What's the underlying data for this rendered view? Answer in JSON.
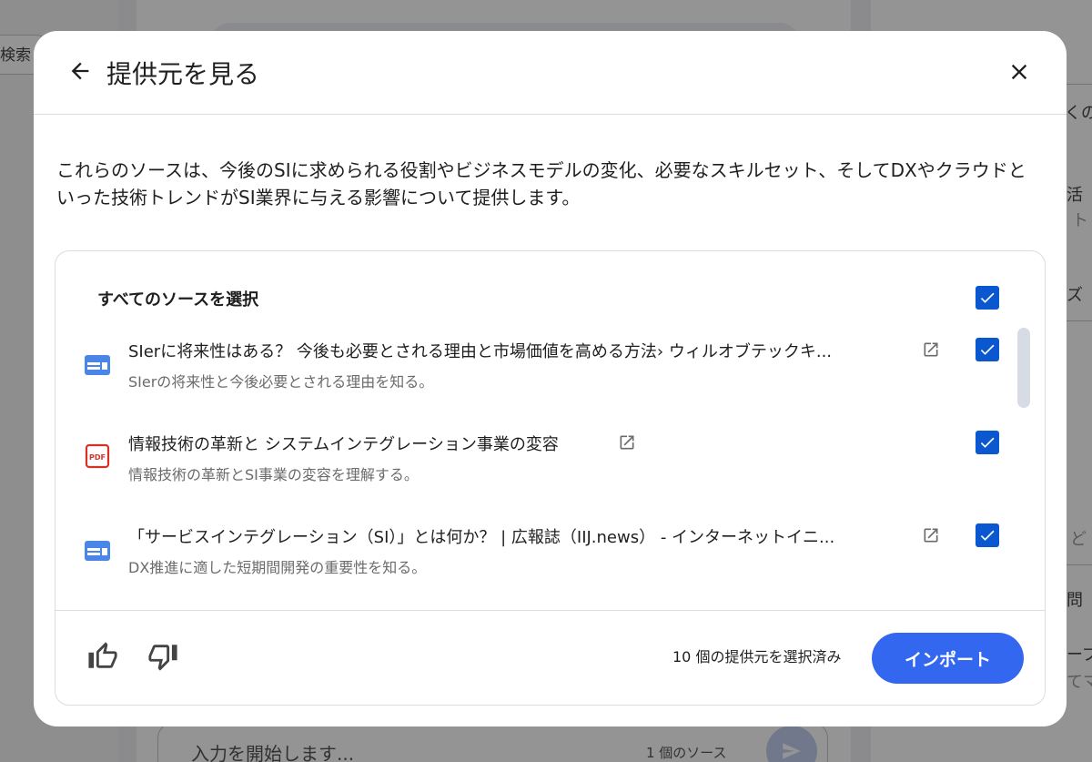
{
  "background": {
    "search_label": "検索",
    "right_texts": [
      "くの",
      "活",
      "ト",
      "ズ",
      "ど",
      "問",
      "ープ",
      "てマ"
    ],
    "input_placeholder": "入力を開始します...",
    "source_count": "1 個のソース"
  },
  "modal": {
    "title": "提供元を見る",
    "description": "これらのソースは、今後のSIに求められる役割やビジネスモデルの変化、必要なスキルセット、そしてDXやクラウドといった技術トレンドがSI業界に与える影響について提供します。",
    "select_all_label": "すべてのソースを選択",
    "select_all_checked": true,
    "sources": [
      {
        "icon": "web-page-icon",
        "title": "SIerに将来性はある？ 今後も必要とされる理由と市場価値を高める方法› ウィルオブテックキ...",
        "subtitle": "SIerの将来性と今後必要とされる理由を知る。",
        "checked": true
      },
      {
        "icon": "pdf-icon",
        "title": "情報技術の革新と システムインテグレーション事業の変容",
        "subtitle": "情報技術の革新とSI事業の変容を理解する。",
        "checked": true
      },
      {
        "icon": "web-page-icon",
        "title": "「サービスインテグレーション（SI）」とは何か？ | 広報誌（IIJ.news） - インターネットイニ...",
        "subtitle": "DX推進に適した短期間開発の重要性を知る。",
        "checked": true
      }
    ],
    "selected_count": "10 個の提供元を選択済み",
    "import_label": "インポート"
  },
  "colors": {
    "accent": "#0b57d0",
    "import_button": "#3367f0",
    "pdf_icon": "#d93025",
    "web_icon": "#4a86e8"
  }
}
